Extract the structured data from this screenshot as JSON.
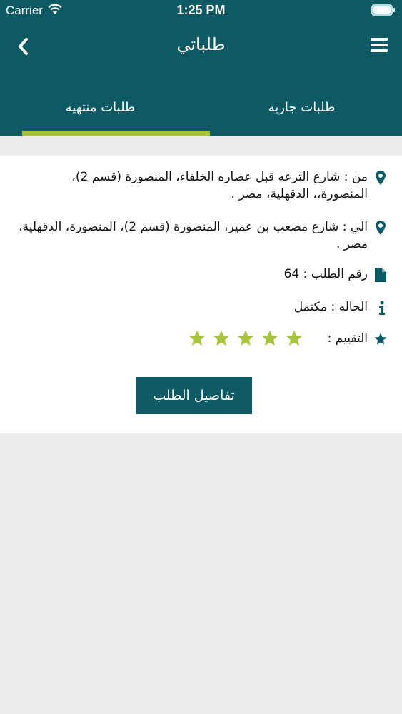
{
  "status_bar": {
    "carrier": "Carrier",
    "time": "1:25 PM"
  },
  "nav": {
    "title": "طلباتي"
  },
  "tabs": [
    {
      "label": "طلبات منتهيه",
      "active": true
    },
    {
      "label": "طلبات جاريه",
      "active": false
    }
  ],
  "order": {
    "from": "من : شارع الترعه قبل عصاره الخلفاء، المنصورة (قسم 2)، المنصورة،، الدقهلية، مصر .",
    "to": "الي : شارع مصعب بن عمير، المنصورة (قسم 2)، المنصورة، الدقهلية، مصر .",
    "number": "رقم الطلب : 64",
    "status": "الحاله : مكتمل",
    "rating_label": "التقييم :",
    "rating": 5,
    "rating_max": 5,
    "details_button": "تفاصيل الطلب"
  },
  "colors": {
    "primary": "#0e5a64",
    "accent": "#a6c43c",
    "background": "#ececec"
  },
  "icons": [
    "back-icon",
    "menu-icon",
    "location-pin-icon",
    "document-icon",
    "info-icon",
    "star-icon"
  ]
}
